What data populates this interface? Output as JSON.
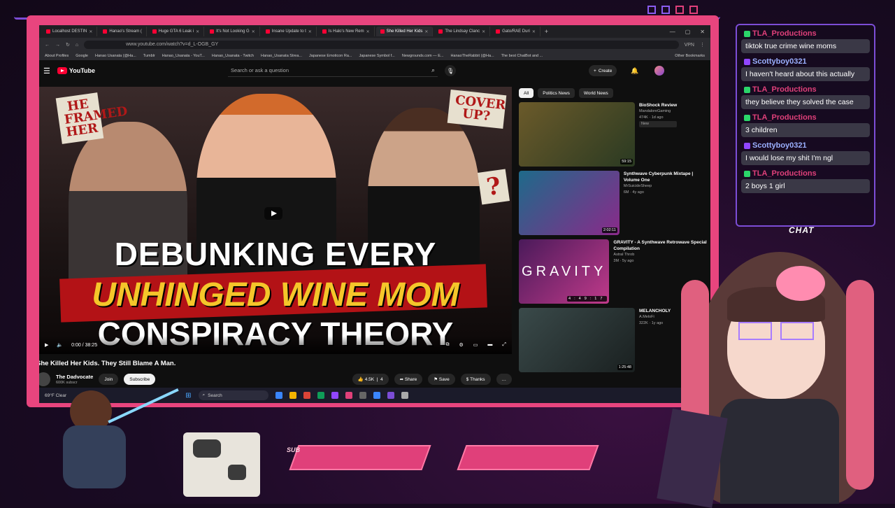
{
  "browser": {
    "tabs": [
      {
        "label": "Localhost DESTIN"
      },
      {
        "label": "Hanao's Stream ("
      },
      {
        "label": "Huge GTA 6 Leak i"
      },
      {
        "label": "It's Not Looking G"
      },
      {
        "label": "Insane Update to t"
      },
      {
        "label": "Is Halo's New Rem"
      },
      {
        "label": "She Killed Her Kids"
      },
      {
        "label": "The Lindsay Clanc"
      },
      {
        "label": "Gato/RAE Duri"
      }
    ],
    "url": "www.youtube.com/watch?v=d_L-OGB_GY",
    "vpn": "VPN",
    "bookmarks": [
      "About Profiles",
      "Google",
      "Hanao Usanata (@Ha...",
      "Tumblr",
      "Hanao_Usanata - YouT...",
      "Hanao_Usanata - Twitch",
      "Hanao_Usanata Strea...",
      "Japanese Emoticon Ra...",
      "Japanese Symbol f...",
      "Newgrounds.com — E...",
      "HanaoTheRabbit (@Ha...",
      "The best ChatBot and ...",
      "Other Bookmarks"
    ]
  },
  "youtube": {
    "logo": "YouTube",
    "search_placeholder": "Search or ask a question",
    "create": "Create",
    "thumbnail": {
      "note1": "HE FRAMED HER",
      "note2": "COVER UP?",
      "note3": "?",
      "line1": "DEBUNKING EVERY",
      "line2": "UNHINGED WINE MOM",
      "line3": "CONSPIRACY THEORY"
    },
    "time": "0:00 / 38:25",
    "video_title": "She Killed Her Kids. They Still Blame A Man.",
    "channel": {
      "name": "The Dadvocate",
      "subs": "600K subscr"
    },
    "join": "Join",
    "subscribe": "Subscribe",
    "likes": "4.5K",
    "dislikes": "4",
    "share": "Share",
    "save": "Save",
    "thanks": "Thanks",
    "chips": [
      "All",
      "Politics News",
      "World News"
    ],
    "recommendations": [
      {
        "title": "BioShock Review",
        "channel": "MandaloreGaming",
        "meta": "474K · 1d ago",
        "badge": "New",
        "duration": "59:15",
        "color1": "#6b5a2a",
        "color2": "#2a3a22"
      },
      {
        "title": "Synthwave Cyberpunk Mixtape | Volume One",
        "channel": "MrSuicideSheep",
        "meta": "6M · 4y ago",
        "duration": "2:02:11",
        "color1": "#1e6a8a",
        "color2": "#8a2a8a"
      },
      {
        "title": "GRAVITY - A Synthwave Retrowave Special Compilation",
        "channel": "Astral Throb",
        "meta": "3M · 5y ago",
        "duration": "4:49:17",
        "color1": "#4a1a5a",
        "color2": "#c03a8a",
        "overlay": "GRAVITY"
      },
      {
        "title": "MELANCHOLY",
        "channel": "A.MeloFi",
        "meta": "322K · 1y ago",
        "duration": "1:25:48",
        "color1": "#3a4a4a",
        "color2": "#1a2020"
      }
    ]
  },
  "taskbar": {
    "weather": "69°F Clear",
    "search": "Search"
  },
  "chat": {
    "label": "CHAT",
    "messages": [
      {
        "user": "TLA_Productions",
        "text": "tiktok true crime wine moms",
        "color": "#e0407a",
        "icon": "#2bd46a"
      },
      {
        "user": "Scottyboy0321",
        "text": "I haven't heard about this actually",
        "color": "#9bb0ff",
        "icon": "#9146ff"
      },
      {
        "user": "TLA_Productions",
        "text": "they believe they solved the case",
        "color": "#e0407a",
        "icon": "#2bd46a"
      },
      {
        "user": "TLA_Productions",
        "text": "3 children",
        "color": "#e0407a",
        "icon": "#2bd46a"
      },
      {
        "user": "Scottyboy0321",
        "text": "I would lose my shit I'm ngl",
        "color": "#9bb0ff",
        "icon": "#9146ff"
      },
      {
        "user": "TLA_Productions",
        "text": "2 boys 1 girl",
        "color": "#e0407a",
        "icon": "#2bd46a"
      }
    ]
  },
  "overlay": {
    "sub_label": "SUB"
  }
}
